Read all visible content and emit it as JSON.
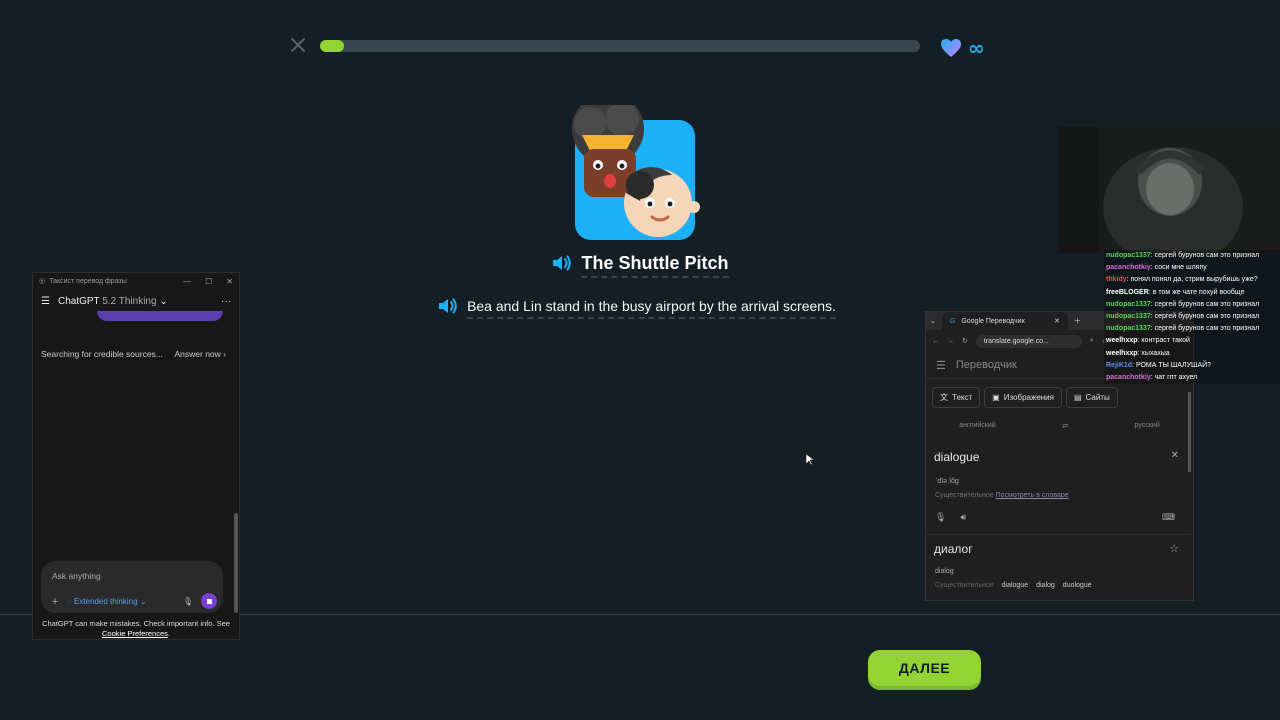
{
  "lesson": {
    "progress_fraction": 0.04,
    "hearts": "∞",
    "story_title": "The Shuttle Pitch",
    "sentence": "Bea and Lin stand in the busy airport by the arrival screens.",
    "continue_label": "ДАЛЕЕ"
  },
  "chatgpt": {
    "window_title": "Таксист перевод фразы",
    "model": "ChatGPT",
    "version": "5.2 Thinking",
    "status": "Searching for credible sources...",
    "answer_now": "Answer now",
    "input_placeholder": "Ask anything",
    "mode": "Extended thinking",
    "disclaimer": "ChatGPT can make mistakes. Check important info. See",
    "cookie_link": "Cookie Preferences"
  },
  "translate": {
    "tab_title": "Google Переводчик",
    "url": "translate.google.co...",
    "app_title": "Переводчик",
    "modes": [
      "Текст",
      "Изображения",
      "Сайты"
    ],
    "source_lang": "английский",
    "target_lang": "русский",
    "source_text": "dialogue",
    "phonetic": "ˈdīəˌlôg",
    "pos": "Существительное",
    "dictionary_link": "Посмотреть в словаре",
    "translation": "диалог",
    "transliteration": "dialog",
    "alt_pos": "Существительное",
    "alternatives": [
      "dialogue",
      "dialog",
      "duologue"
    ]
  },
  "chat": [
    {
      "user": "nudopac1337",
      "text": "сергей бурунов сам это признал",
      "color": "#5ed15e"
    },
    {
      "user": "pacanchotkiy",
      "text": "соси мне шляпу",
      "color": "#d46dd4"
    },
    {
      "user": "thkidy",
      "text": "понял понял да, стрим вырубишь уже?",
      "color": "#e05555"
    },
    {
      "user": "freeBLOGER",
      "text": "в том же чате похуй вообще",
      "color": "#ffffff"
    },
    {
      "user": "nudopac1337",
      "text": "сергей бурунов сам это признал",
      "color": "#5ed15e"
    },
    {
      "user": "nudopac1337",
      "text": "сергей бурунов сам это признал",
      "color": "#5ed15e"
    },
    {
      "user": "nudopac1337",
      "text": "сергей бурунов сам это признал",
      "color": "#5ed15e"
    },
    {
      "user": "weelhxxp",
      "text": "контраст такой",
      "color": "#ffffff"
    },
    {
      "user": "weelhxxp",
      "text": "хыхахыа",
      "color": "#ffffff"
    },
    {
      "user": "RejiK1d",
      "text": "РОМА ТЫ ШАЛУШАЙ?",
      "color": "#5a8ff0"
    },
    {
      "user": "pacanchotkiy",
      "text": "чат гпт ахуел",
      "color": "#d46dd4"
    }
  ]
}
